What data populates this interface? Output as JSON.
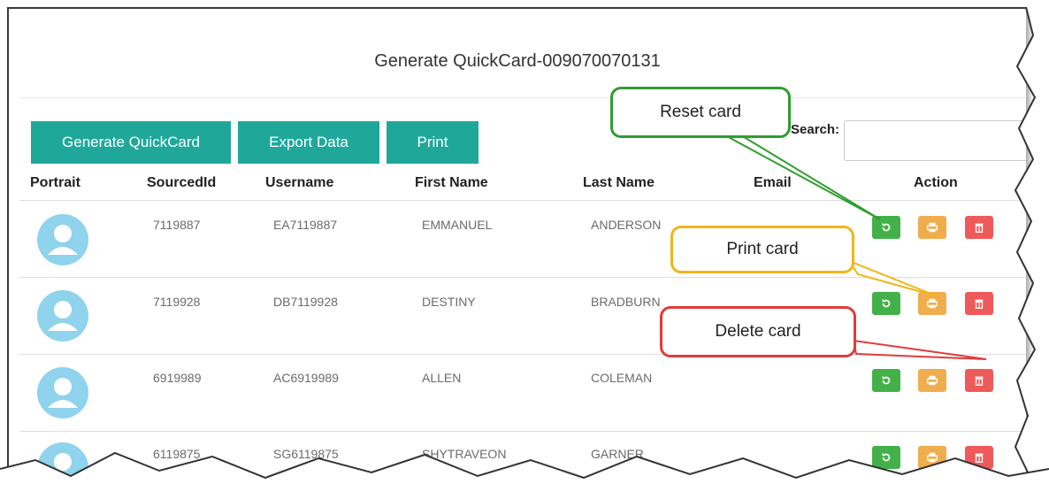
{
  "page_title": "Generate QuickCard-009070070131",
  "toolbar": {
    "generate_label": "Generate QuickCard",
    "export_label": "Export Data",
    "print_label": "Print"
  },
  "search": {
    "label": "Search:",
    "value": ""
  },
  "columns": [
    "Portrait",
    "SourcedId",
    "Username",
    "First Name",
    "Last Name",
    "Email",
    "Action"
  ],
  "rows": [
    {
      "sourcedid": "7119887",
      "username": "EA7119887",
      "first": "EMMANUEL",
      "last": "ANDERSON",
      "email": ""
    },
    {
      "sourcedid": "7119928",
      "username": "DB7119928",
      "first": "DESTINY",
      "last": "BRADBURN",
      "email": ""
    },
    {
      "sourcedid": "6919989",
      "username": "AC6919989",
      "first": "ALLEN",
      "last": "COLEMAN",
      "email": ""
    },
    {
      "sourcedid": "6119875",
      "username": "SG6119875",
      "first": "SHYTRAVEON",
      "last": "GARNER",
      "email": ""
    }
  ],
  "callouts": {
    "reset": "Reset card",
    "print": "Print card",
    "delete": "Delete card"
  },
  "colors": {
    "primary": "#1fa89a",
    "reset": "#44b04a",
    "print": "#f0ad4e",
    "delete": "#ee5a5a",
    "callout_reset": "#2e9e2e",
    "callout_print": "#f2b51a",
    "callout_delete": "#e03b3b"
  },
  "icons": {
    "reset": "refresh-icon",
    "print": "printer-icon",
    "delete": "trash-icon",
    "portrait": "user-avatar-icon"
  }
}
